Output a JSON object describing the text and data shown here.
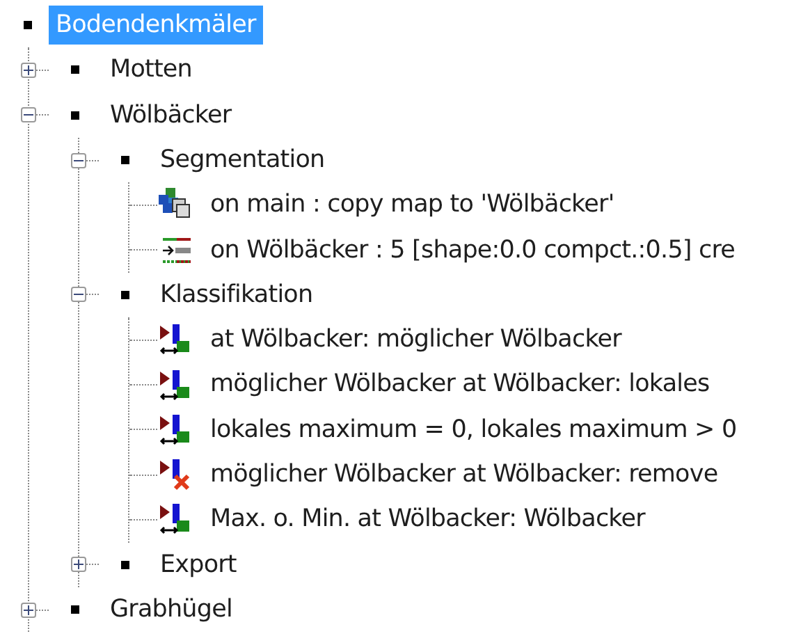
{
  "tree": [
    {
      "kind": "category",
      "label": "Bodendenkmäler",
      "selected": true,
      "expanded": true,
      "children": [
        {
          "kind": "category",
          "label": "Motten",
          "selected": false,
          "expanded": false
        },
        {
          "kind": "category",
          "label": "Wölbäcker",
          "selected": false,
          "expanded": true,
          "children": [
            {
              "kind": "category",
              "label": "Segmentation",
              "selected": false,
              "expanded": true,
              "children": [
                {
                  "kind": "copy-map",
                  "label": "on main : copy map to 'Wölbäcker'",
                  "selected": false
                },
                {
                  "kind": "segmentation",
                  "label": "on Wölbäcker : 5 [shape:0.0 compct.:0.5] cre",
                  "selected": false
                }
              ]
            },
            {
              "kind": "category",
              "label": "Klassifikation",
              "selected": false,
              "expanded": true,
              "children": [
                {
                  "kind": "classification",
                  "label": "at  Wölbacker: möglicher Wölbacker",
                  "selected": false
                },
                {
                  "kind": "classification",
                  "label": "möglicher Wölbacker at  Wölbacker: lokales",
                  "selected": false
                },
                {
                  "kind": "classification",
                  "label": "lokales maximum = 0, lokales maximum > 0",
                  "selected": false
                },
                {
                  "kind": "remove",
                  "label": "möglicher Wölbacker at  Wölbacker: remove",
                  "selected": false
                },
                {
                  "kind": "classification",
                  "label": "Max. o. Min. at  Wölbacker: Wölbacker",
                  "selected": false
                }
              ]
            },
            {
              "kind": "category",
              "label": "Export",
              "selected": false,
              "expanded": false
            }
          ]
        },
        {
          "kind": "category",
          "label": "Grabhügel",
          "selected": false,
          "expanded": false
        }
      ]
    }
  ]
}
